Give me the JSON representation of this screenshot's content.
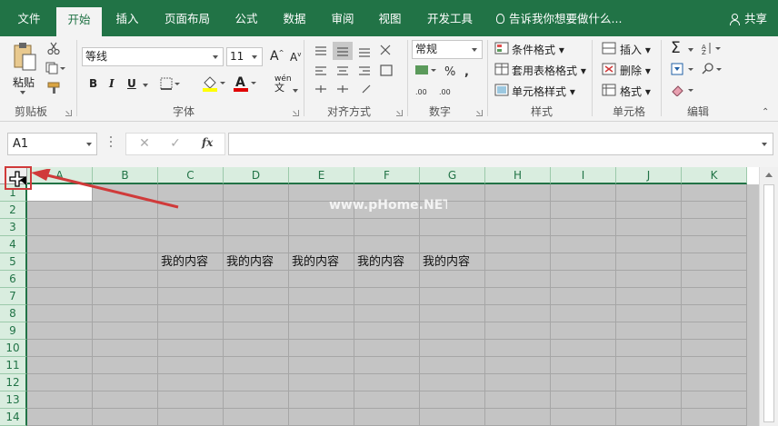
{
  "tabs": [
    "文件",
    "开始",
    "插入",
    "页面布局",
    "公式",
    "数据",
    "审阅",
    "视图",
    "开发工具"
  ],
  "active_tab": "开始",
  "tell_me": "告诉我你想要做什么...",
  "share": "共享",
  "ribbon": {
    "clipboard": {
      "label": "剪贴板",
      "paste": "粘贴"
    },
    "font": {
      "label": "字体",
      "name": "等线",
      "size": "11",
      "bold": "B",
      "italic": "I",
      "underline": "U",
      "phonetic": "wén"
    },
    "alignment": {
      "label": "对齐方式"
    },
    "number": {
      "label": "数字",
      "format": "常规"
    },
    "styles": {
      "label": "样式",
      "conditional": "条件格式",
      "table": "套用表格格式",
      "cell_styles": "单元格样式"
    },
    "cells": {
      "label": "单元格",
      "insert": "插入",
      "delete": "删除",
      "format": "格式"
    },
    "editing": {
      "label": "编辑"
    }
  },
  "formula_bar": {
    "name_box": "A1",
    "cancel": "✕",
    "enter": "✓",
    "fx": "fx",
    "content": ""
  },
  "columns": [
    "A",
    "B",
    "C",
    "D",
    "E",
    "F",
    "G",
    "H",
    "I",
    "J",
    "K"
  ],
  "rows": [
    "1",
    "2",
    "3",
    "4",
    "5",
    "6",
    "7",
    "8",
    "9",
    "10",
    "11",
    "12",
    "13",
    "14"
  ],
  "row5_cells": [
    "我的内容",
    "我的内容",
    "我的内容",
    "我的内容",
    "我的内容"
  ],
  "watermark": "www.pHome.NET",
  "colors": {
    "excel_green": "#217346",
    "select_gray": "#c4c4c4",
    "annotation_red": "#d03a3a"
  }
}
